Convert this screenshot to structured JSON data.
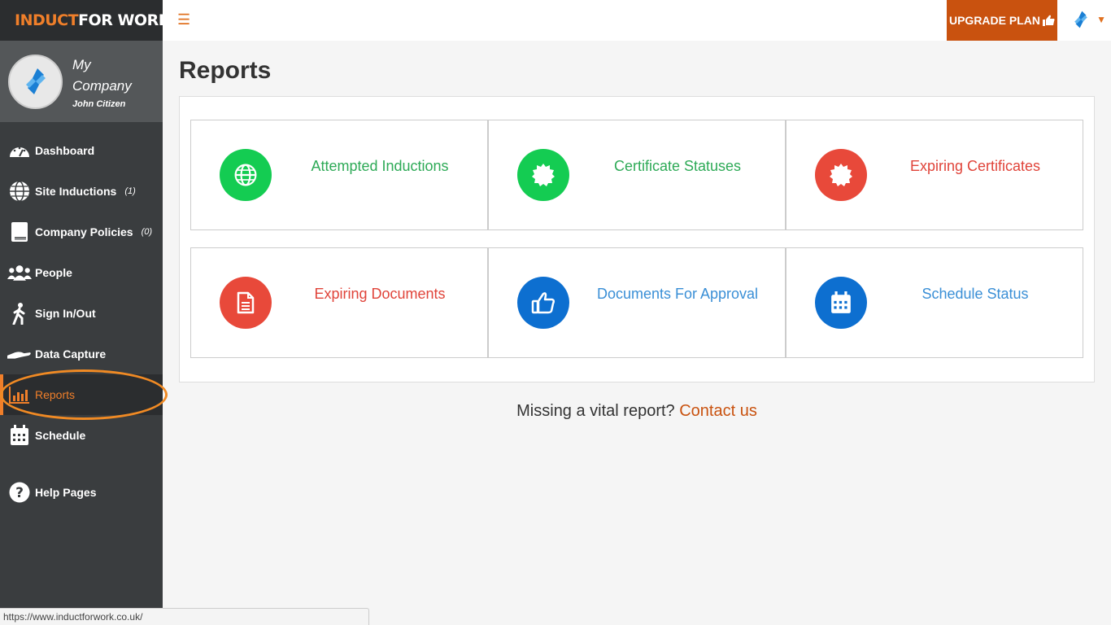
{
  "brand": {
    "part1": "INDUCT",
    "part2": "FOR WORK"
  },
  "profile": {
    "company": "My Company",
    "user": "John Citizen"
  },
  "sidebar": {
    "items": [
      {
        "label": "Dashboard",
        "icon": "dashboard-gauge-icon",
        "count": ""
      },
      {
        "label": "Site Inductions",
        "icon": "globe-icon",
        "count": "(1)"
      },
      {
        "label": "Company Policies",
        "icon": "book-icon",
        "count": "(0)"
      },
      {
        "label": "People",
        "icon": "people-icon",
        "count": ""
      },
      {
        "label": "Sign In/Out",
        "icon": "walking-person-icon",
        "count": ""
      },
      {
        "label": "Data Capture",
        "icon": "hand-icon",
        "count": ""
      },
      {
        "label": "Reports",
        "icon": "bar-chart-icon",
        "count": "",
        "active": true
      },
      {
        "label": "Schedule",
        "icon": "calendar-icon",
        "count": ""
      },
      {
        "label": "Help Pages",
        "icon": "question-circle-icon",
        "count": ""
      }
    ]
  },
  "topbar": {
    "upgrade_label": "UPGRADE PLAN"
  },
  "page": {
    "title": "Reports"
  },
  "tiles": [
    {
      "label": "Attempted Inductions",
      "icon": "globe-icon",
      "color": "#14cc52"
    },
    {
      "label": "Certificate Statuses",
      "icon": "certificate-icon",
      "color": "#14cc52"
    },
    {
      "label": "Expiring Certificates",
      "icon": "certificate-icon",
      "color": "#e8493a"
    },
    {
      "label": "Expiring Documents",
      "icon": "document-icon",
      "color": "#e8493a"
    },
    {
      "label": "Documents For Approval",
      "icon": "thumbs-up-icon",
      "color": "#0d6fd0"
    },
    {
      "label": "Schedule Status",
      "icon": "calendar-icon",
      "color": "#0d6fd0"
    }
  ],
  "footer": {
    "missing_text": "Missing a vital report?",
    "contact_link": "Contact us"
  },
  "status_bar": {
    "url": "https://www.inductforwork.co.uk/"
  }
}
